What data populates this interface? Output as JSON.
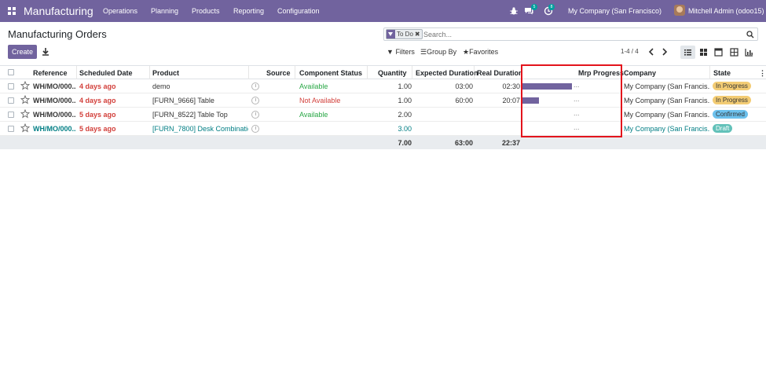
{
  "navbar": {
    "app_name": "Manufacturing",
    "menus": [
      "Operations",
      "Planning",
      "Products",
      "Reporting",
      "Configuration"
    ],
    "chat_badge": "5",
    "activity_badge": "8",
    "company": "My Company (San Francisco)",
    "user": "Mitchell Admin (odoo15)"
  },
  "page": {
    "title": "Manufacturing Orders",
    "create_label": "Create"
  },
  "search": {
    "facet": "To Do",
    "placeholder": "Search...",
    "filters_label": "Filters",
    "groupby_label": "Group By",
    "favorites_label": "Favorites"
  },
  "pager": {
    "value": "1-4 / 4"
  },
  "table": {
    "columns": {
      "reference": "Reference",
      "scheduled_date": "Scheduled Date",
      "product": "Product",
      "source": "Source",
      "component_status": "Component Status",
      "quantity": "Quantity",
      "expected_duration": "Expected Duration",
      "real_duration": "Real Duration",
      "mrp_progress": "Mrp Progress",
      "company": "Company",
      "state": "State"
    },
    "rows": [
      {
        "reference": "WH/MO/000...",
        "date": "4 days ago",
        "product": "demo",
        "component_status": "Available",
        "quantity": "1.00",
        "expected": "03:00",
        "real": "02:30",
        "progress": 0.98,
        "dots": "...",
        "company": "My Company (San Francis...",
        "state": "In Progress"
      },
      {
        "reference": "WH/MO/000...",
        "date": "4 days ago",
        "product": "[FURN_9666] Table",
        "component_status": "Not Available",
        "quantity": "1.00",
        "expected": "60:00",
        "real": "20:07",
        "progress": 0.33,
        "dots": "...",
        "company": "My Company (San Francis...",
        "state": "In Progress"
      },
      {
        "reference": "WH/MO/000...",
        "date": "5 days ago",
        "product": "[FURN_8522] Table Top",
        "component_status": "Available",
        "quantity": "2.00",
        "expected": "",
        "real": "",
        "progress": 0,
        "dots": "...",
        "company": "My Company (San Francis...",
        "state": "Confirmed"
      },
      {
        "reference": "WH/MO/000...",
        "date": "5 days ago",
        "product": "[FURN_7800] Desk Combination",
        "component_status": "",
        "quantity": "3.00",
        "expected": "",
        "real": "",
        "progress": 0,
        "dots": "...",
        "company": "My Company (San Francis...",
        "state": "Draft"
      }
    ],
    "totals": {
      "quantity": "7.00",
      "expected": "63:00",
      "real": "22:37"
    }
  },
  "colors": {
    "brand": "#71639e",
    "late": "#d23f3a",
    "available": "#28a745",
    "draft_row": "#017e84",
    "highlight": "#e3141c"
  }
}
